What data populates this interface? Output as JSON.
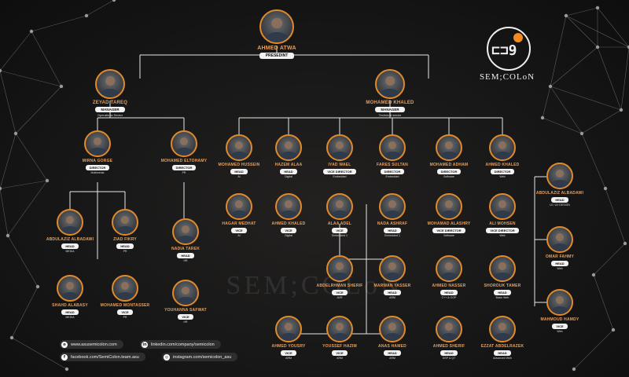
{
  "brand": {
    "name": "SEM;COLoN",
    "glyph": "⊏⊐9",
    "accent": "#f18a21",
    "watermark": "SEM;COLoN"
  },
  "socials": [
    {
      "icon": "globe-icon",
      "glyph": "⊕",
      "text": "www.asusemicolon.com"
    },
    {
      "icon": "linkedin-icon",
      "glyph": "in",
      "text": "linkedin.com/company/semicolon"
    },
    {
      "icon": "facebook-icon",
      "glyph": "f",
      "text": "facebook.com/SemiColon.team.asu"
    },
    {
      "icon": "instagram-icon",
      "glyph": "◎",
      "text": "instagram.com/semicolon_asu"
    }
  ],
  "people": [
    {
      "id": "atwa",
      "name": "AHMED ATWA",
      "role": "PRESEDINT",
      "dept": ""
    },
    {
      "id": "zeyad",
      "name": "ZEYAD TAREQ",
      "role": "MANAGER",
      "dept": "Operations Sector"
    },
    {
      "id": "mkhaled",
      "name": "MOHAMED KHALED",
      "role": "MANAGER",
      "dept": "Technical sector"
    },
    {
      "id": "mirna",
      "name": "MIRNA GORGE",
      "role": "DIRECTOR",
      "dept": "Multimedia"
    },
    {
      "id": "eltohamy",
      "name": "MOHAMED ELTOHAMY",
      "role": "DIRECTOR",
      "dept": "PR"
    },
    {
      "id": "hussein",
      "name": "MOHAMED HUSSEIN",
      "role": "HEAD",
      "dept": "AI"
    },
    {
      "id": "hazem",
      "name": "HAZEM ALAA",
      "role": "HEAD",
      "dept": "Digital"
    },
    {
      "id": "iyad",
      "name": "IYAD WAEL",
      "role": "VICE DIRECTOR",
      "dept": "Embedded"
    },
    {
      "id": "fares",
      "name": "FARES SULTAN",
      "role": "DIRECTOR",
      "dept": "Embedded"
    },
    {
      "id": "adham",
      "name": "MOHAMED ADHAM",
      "role": "DIRECTOR",
      "dept": "Software"
    },
    {
      "id": "akhaled",
      "name": "AHMED KHALED",
      "role": "DIRECTOR",
      "dept": "Web"
    },
    {
      "id": "abdulaziz1",
      "name": "ABDULAZIZ ALBADAWI",
      "role": "HEAD",
      "dept": "MEDIA"
    },
    {
      "id": "ziad",
      "name": "ZIAD FIKRY",
      "role": "HEAD",
      "dept": "PR"
    },
    {
      "id": "nadia",
      "name": "NADIA TAREK",
      "role": "HEAD",
      "dept": "HR"
    },
    {
      "id": "hagar",
      "name": "HAGAR MEDHAT",
      "role": "VICE",
      "dept": "AI"
    },
    {
      "id": "akhaled2",
      "name": "AHMED KHALED",
      "role": "VICE",
      "dept": "Digital"
    },
    {
      "id": "alaa",
      "name": "ALAA ADEL",
      "role": "VICE",
      "dept": "Embedded 1"
    },
    {
      "id": "nada",
      "name": "NADA ASHRAF",
      "role": "HEAD",
      "dept": "Embedded 1"
    },
    {
      "id": "alashry",
      "name": "MOHAMAD ALASHRY",
      "role": "VICE DIRECTOR",
      "dept": "Software"
    },
    {
      "id": "mohsen",
      "name": "ALI MOHSEN",
      "role": "VICE DIRECTOR",
      "dept": "Web"
    },
    {
      "id": "abdulaziz2",
      "name": "ABDULAZIZ ALBADAWI",
      "role": "HEAD",
      "dept": "UI / UX DESIGN"
    },
    {
      "id": "shahd",
      "name": "SHAHD ALABASY",
      "role": "HEAD",
      "dept": "MEDIA"
    },
    {
      "id": "montasser",
      "name": "MOHAMED MONTASSER",
      "role": "VICE",
      "dept": "PR"
    },
    {
      "id": "youhanna",
      "name": "YOUHANNA SAFWAT",
      "role": "VICE",
      "dept": "HR"
    },
    {
      "id": "sherif1",
      "name": "ABDELRHMAN SHERIF",
      "role": "VICE",
      "dept": "AVR"
    },
    {
      "id": "marwan",
      "name": "MARWAN YASSER",
      "role": "HEAD",
      "dept": "ARM"
    },
    {
      "id": "nasser",
      "name": "AHMED NASSER",
      "role": "HEAD",
      "dept": "C++ & OOP"
    },
    {
      "id": "shorouk",
      "name": "SHOROUK TAMER",
      "role": "HEAD",
      "dept": "Basic Web"
    },
    {
      "id": "omar",
      "name": "OMAR FAHMY",
      "role": "HEAD",
      "dept": "Web"
    },
    {
      "id": "hamdy",
      "name": "MAHMOUD HAMDY",
      "role": "VICE",
      "dept": "Web"
    },
    {
      "id": "yousry",
      "name": "AHMED YOUSRY",
      "role": "VICE",
      "dept": "ARM"
    },
    {
      "id": "hazim",
      "name": "YOUSSEF HAZIM",
      "role": "VICE",
      "dept": "ARM"
    },
    {
      "id": "anas",
      "name": "ANAS HAMED",
      "role": "HEAD",
      "dept": "ARM"
    },
    {
      "id": "sherif2",
      "name": "AHMED SHERIF",
      "role": "HEAD",
      "dept": "DSP & QT"
    },
    {
      "id": "ezzat",
      "name": "EZZAT ABDELRAZEK",
      "role": "HEAD",
      "dept": "Advanced Web"
    }
  ]
}
